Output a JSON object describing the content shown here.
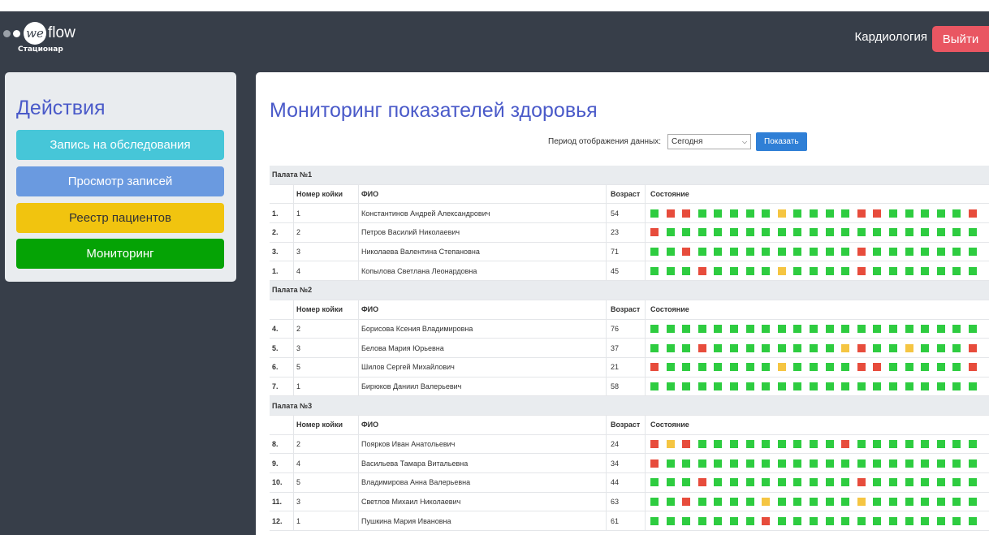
{
  "header": {
    "logo_prefix": "we",
    "logo_suffix": "flow",
    "logo_sub": "Стационар",
    "department": "Кардиология",
    "logout_label": "Выйти"
  },
  "sidebar": {
    "title": "Действия",
    "buttons": [
      {
        "label": "Запись на обследования",
        "bg": "#46c6d8",
        "fg": "#ffffff"
      },
      {
        "label": "Просмотр записей",
        "bg": "#6a9ae0",
        "fg": "#ffffff"
      },
      {
        "label": "Реестр пациентов",
        "bg": "#f1c40f",
        "fg": "#333333"
      },
      {
        "label": "Мониторинг",
        "bg": "#05a305",
        "fg": "#ffffff"
      }
    ]
  },
  "main": {
    "title": "Мониторинг показателей здоровья",
    "period_label": "Период отображения данных:",
    "period_value": "Сегодня",
    "show_label": "Показать",
    "columns": {
      "bed": "Номер койки",
      "name": "ФИО",
      "age": "Возраст",
      "status": "Состояние"
    },
    "colors": {
      "G": "#2ecc40",
      "R": "#e74c3c",
      "Y": "#f5c542"
    },
    "wards": [
      {
        "title": "Палата №1",
        "patients": [
          {
            "idx": "1.",
            "bed": "1",
            "name": "Константинов Андрей Александрович",
            "age": "54",
            "status": "GRRGGGGGYGGGGRRGGGGGR"
          },
          {
            "idx": "2.",
            "bed": "2",
            "name": "Петров Василий Николаевич",
            "age": "23",
            "status": "RGGGGGGGGGGGGGGGGGGGG"
          },
          {
            "idx": "3.",
            "bed": "3",
            "name": "Николаева Валентина Степановна",
            "age": "71",
            "status": "GGRGGGGGGGGGGRGGGGGGG"
          },
          {
            "idx": "1.",
            "bed": "4",
            "name": "Копылова Светлана Леонардовна",
            "age": "45",
            "status": "GGGRGGGGYGGGGRGGGGGGG"
          }
        ]
      },
      {
        "title": "Палата №2",
        "patients": [
          {
            "idx": "4.",
            "bed": "2",
            "name": "Борисова Ксения Владимировна",
            "age": "76",
            "status": "GGGGGGGGGGGGGGGGGGGGG"
          },
          {
            "idx": "5.",
            "bed": "3",
            "name": "Белова Мария Юрьевна",
            "age": "37",
            "status": "GGGRGGGGGGGGYRGGYGGGR"
          },
          {
            "idx": "6.",
            "bed": "5",
            "name": "Шилов Сергей Михайлович",
            "age": "21",
            "status": "RGGGGGGGYGGGGRRGGGGGR"
          },
          {
            "idx": "7.",
            "bed": "1",
            "name": "Бирюков Даниил Валерьевич",
            "age": "58",
            "status": "GGGGGGGGGGGGGGGGGGGGG"
          }
        ]
      },
      {
        "title": "Палата №3",
        "patients": [
          {
            "idx": "8.",
            "bed": "2",
            "name": "Поярков Иван Анатольевич",
            "age": "24",
            "status": "RYRGGGGGGGGGRGGGGGGGG"
          },
          {
            "idx": "9.",
            "bed": "4",
            "name": "Васильева Тамара Витальевна",
            "age": "34",
            "status": "RGGGGGGGGGGGGGGGGGGGG"
          },
          {
            "idx": "10.",
            "bed": "5",
            "name": "Владимирова Анна Валерьевна",
            "age": "44",
            "status": "GGGRGGGGGGGGGRGGGGGGG"
          },
          {
            "idx": "11.",
            "bed": "3",
            "name": "Светлов Михаил Николаевич",
            "age": "63",
            "status": "GGRGGGGYGGGGGYGGGGGGG"
          },
          {
            "idx": "12.",
            "bed": "1",
            "name": "Пушкина Мария Ивановна",
            "age": "61",
            "status": "GGGGGGGRGGGGGGGGGGGGG"
          }
        ]
      }
    ]
  }
}
